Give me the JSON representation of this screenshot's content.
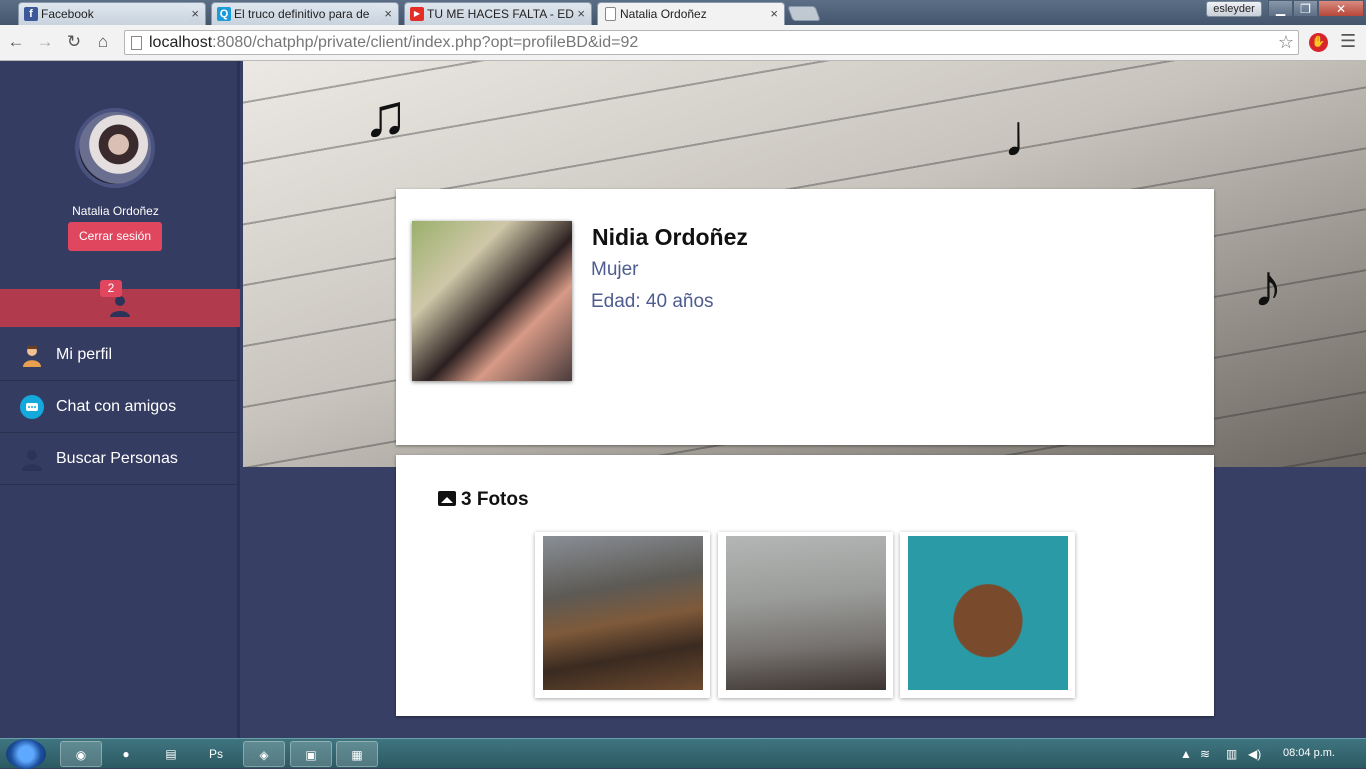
{
  "browser": {
    "tabs": [
      {
        "title": "Facebook",
        "icon": "facebook-icon",
        "color": "#3b5998",
        "glyph": "f"
      },
      {
        "title": "El truco definitivo para de",
        "icon": "chat-icon",
        "color": "#1b9bd8",
        "glyph": "Q"
      },
      {
        "title": "TU ME HACES FALTA - EDI",
        "icon": "youtube-icon",
        "color": "#e52d27",
        "glyph": "▶"
      },
      {
        "title": "Natalia Ordoñez",
        "icon": "page-icon",
        "color": "#ffffff",
        "glyph": ""
      }
    ],
    "profile_user": "esleyder",
    "url_host": "localhost",
    "url_rest": ":8080/chatphp/private/client/index.php?opt=profileBD&id=92"
  },
  "sidebar": {
    "user_name": "Natalia Ordoñez",
    "logout_label": "Cerrar sesión",
    "notification_count": "2",
    "items": [
      {
        "label": "Mi perfil",
        "icon": "profile-icon"
      },
      {
        "label": "Chat con amigos",
        "icon": "chat-icon"
      },
      {
        "label": "Buscar Personas",
        "icon": "search-people-icon"
      }
    ]
  },
  "profile": {
    "name": "Nidia Ordoñez",
    "gender": "Mujer",
    "age": "Edad: 40 años"
  },
  "photos": {
    "title": "3 Fotos",
    "items": [
      "photo-1",
      "photo-2",
      "photo-3"
    ]
  },
  "taskbar": {
    "clock": "08:04 p.m."
  },
  "colors": {
    "accent": "#e0475f",
    "sidebar": "#353c61",
    "link_text": "#4e5c90"
  }
}
